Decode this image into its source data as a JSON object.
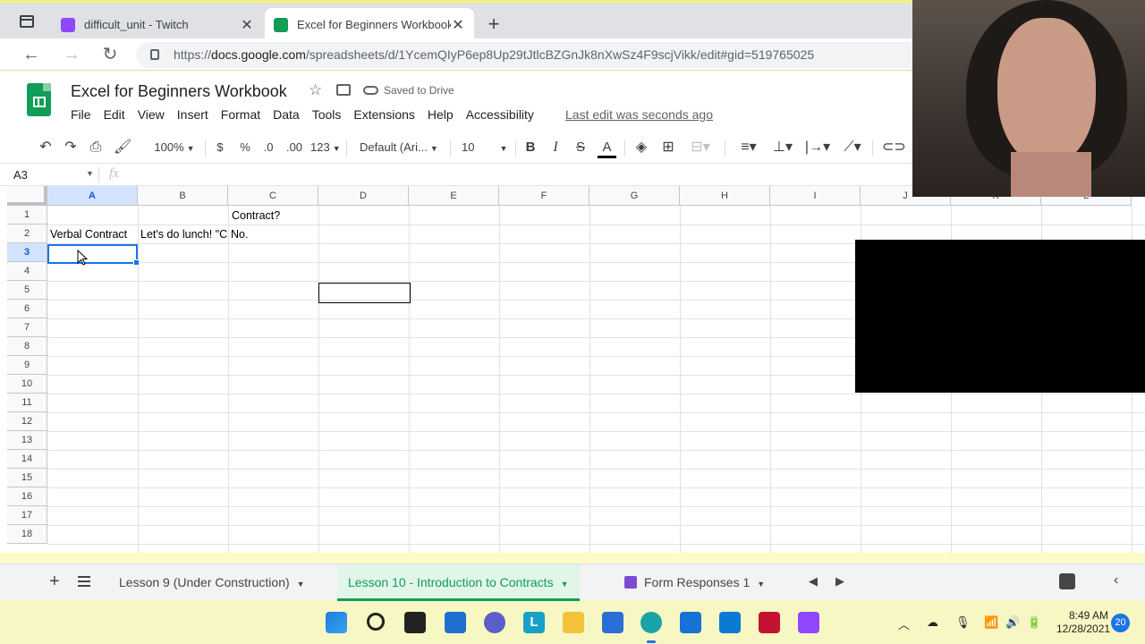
{
  "browser": {
    "tabs": [
      {
        "title": "difficult_unit - Twitch",
        "favicon": "twitch-icon"
      },
      {
        "title": "Excel for Beginners Workbook - G",
        "favicon": "sheets-icon"
      }
    ],
    "url_prefix": "https://",
    "url_domain": "docs.google.com",
    "url_path": "/spreadsheets/d/1YcemQIyP6ep8Up29tJtlcBZGnJk8nXwSz4F9scjVikk/edit#gid=519765025"
  },
  "sheets": {
    "title": "Excel for Beginners Workbook",
    "saved_status": "Saved to Drive",
    "menu": [
      "File",
      "Edit",
      "View",
      "Insert",
      "Format",
      "Data",
      "Tools",
      "Extensions",
      "Help",
      "Accessibility"
    ],
    "last_edit": "Last edit was seconds ago",
    "toolbar": {
      "zoom": "100%",
      "currency": "$",
      "percent": "%",
      "dec_decrease": ".0",
      "dec_increase": ".00",
      "more_formats": "123",
      "font": "Default (Ari...",
      "font_size": "10",
      "bold": "B",
      "italic": "I",
      "strike": "S",
      "text_color": "A"
    },
    "name_box": "A3",
    "fx": "fx",
    "columns": [
      "A",
      "B",
      "C",
      "D",
      "E",
      "F",
      "G",
      "H",
      "I",
      "J",
      "K",
      "L"
    ],
    "rows": [
      "1",
      "2",
      "3",
      "4",
      "5",
      "6",
      "7",
      "8",
      "9",
      "10",
      "11",
      "12",
      "13",
      "14",
      "15",
      "16",
      "17",
      "18"
    ],
    "cells": {
      "C1": "Contract?",
      "A2": "Verbal Contract",
      "B2": "Let's do lunch! \"C",
      "C2": "No."
    },
    "selected_cell": "A3",
    "sheet_tabs": [
      {
        "label": "Lesson 9 (Under Construction)",
        "active": false
      },
      {
        "label": "Lesson 10 - Introduction to Contracts",
        "active": true
      },
      {
        "label": "Form Responses 1",
        "active": false
      }
    ]
  },
  "taskbar": {
    "time": "8:49 AM",
    "date": "12/28/2021",
    "notifications": "20",
    "apps": [
      "windows-start-icon",
      "search-icon",
      "task-view-icon",
      "widgets-icon",
      "chat-icon",
      "l-app-icon",
      "file-explorer-icon",
      "store-icon",
      "edge-icon",
      "mail-icon",
      "outlook-icon",
      "mcafee-icon",
      "twitch-icon"
    ]
  },
  "colors": {
    "sheets_green": "#0f9d58",
    "selection_blue": "#1a73e8",
    "twitch_purple": "#9146ff"
  }
}
